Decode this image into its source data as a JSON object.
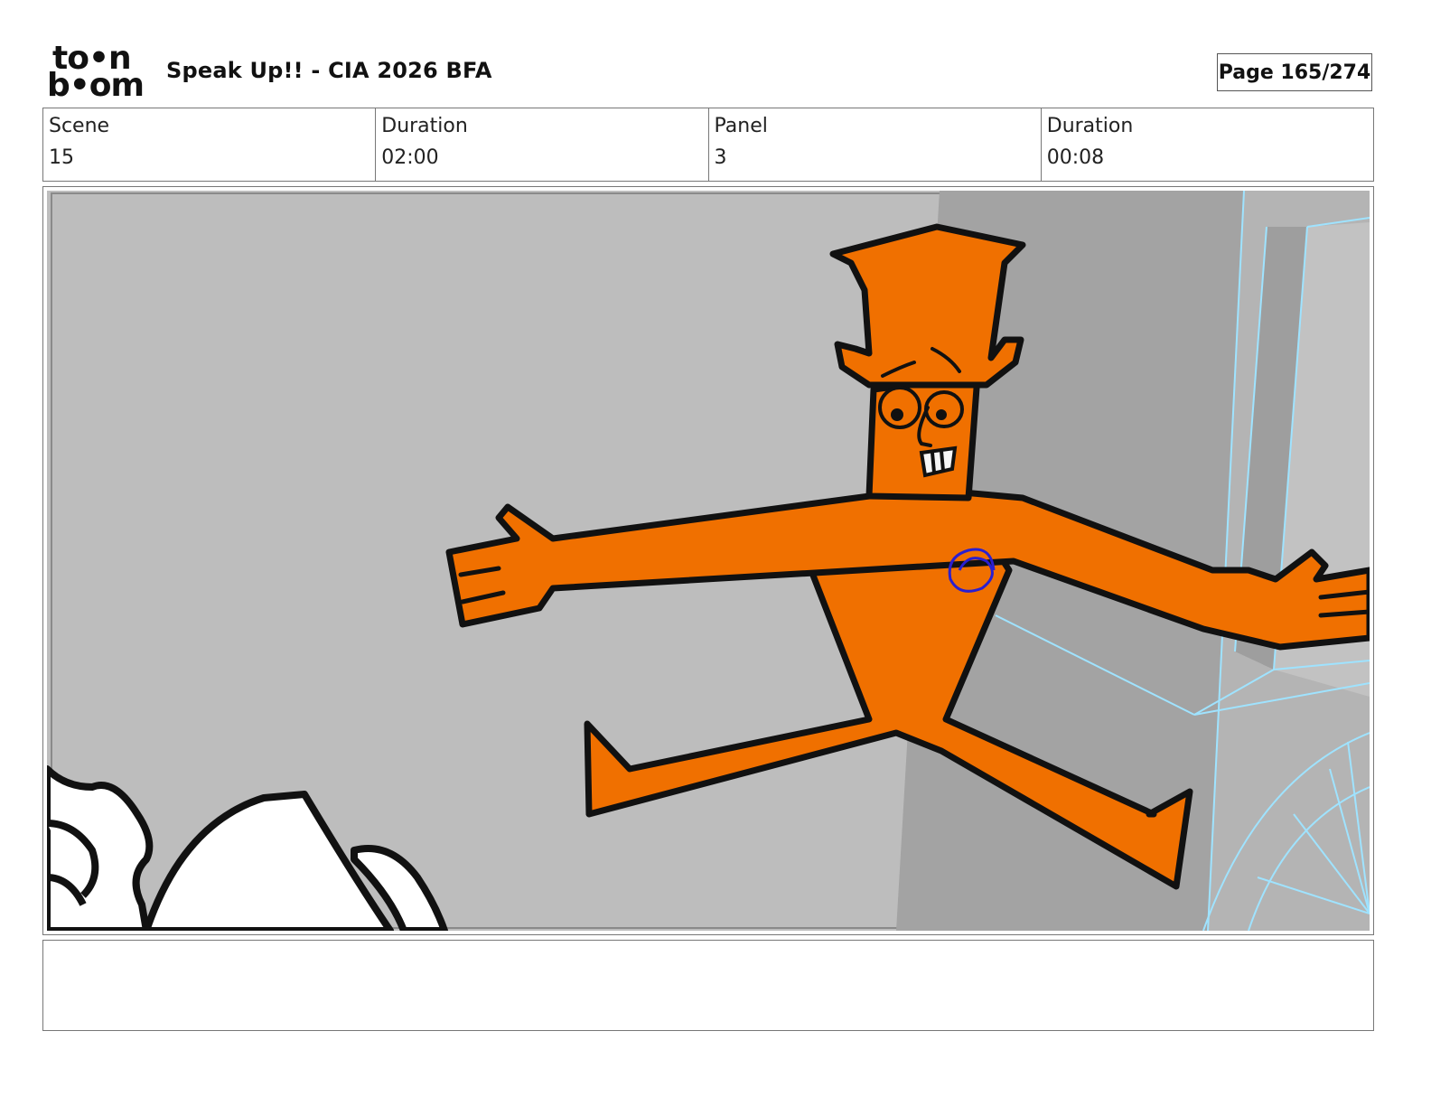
{
  "header": {
    "logo_top": "to•n",
    "logo_bottom": "b•om",
    "title": "Speak Up!! - CIA 2026 BFA",
    "page": "Page 165/274"
  },
  "info": {
    "scene_label": "Scene",
    "scene_value": "15",
    "scene_duration_label": "Duration",
    "scene_duration_value": "02:00",
    "panel_label": "Panel",
    "panel_value": "3",
    "panel_duration_label": "Duration",
    "panel_duration_value": "00:08"
  },
  "panel": {
    "description_icon": "storyboard-drawing",
    "colors": {
      "background": "#bdbdbd",
      "wall": "#a3a3a3",
      "character": "#f07000",
      "outline": "#111111",
      "chest_mark": "#2a1fd0",
      "wireframe": "#9fe3ff"
    }
  },
  "notes": {
    "text": ""
  }
}
